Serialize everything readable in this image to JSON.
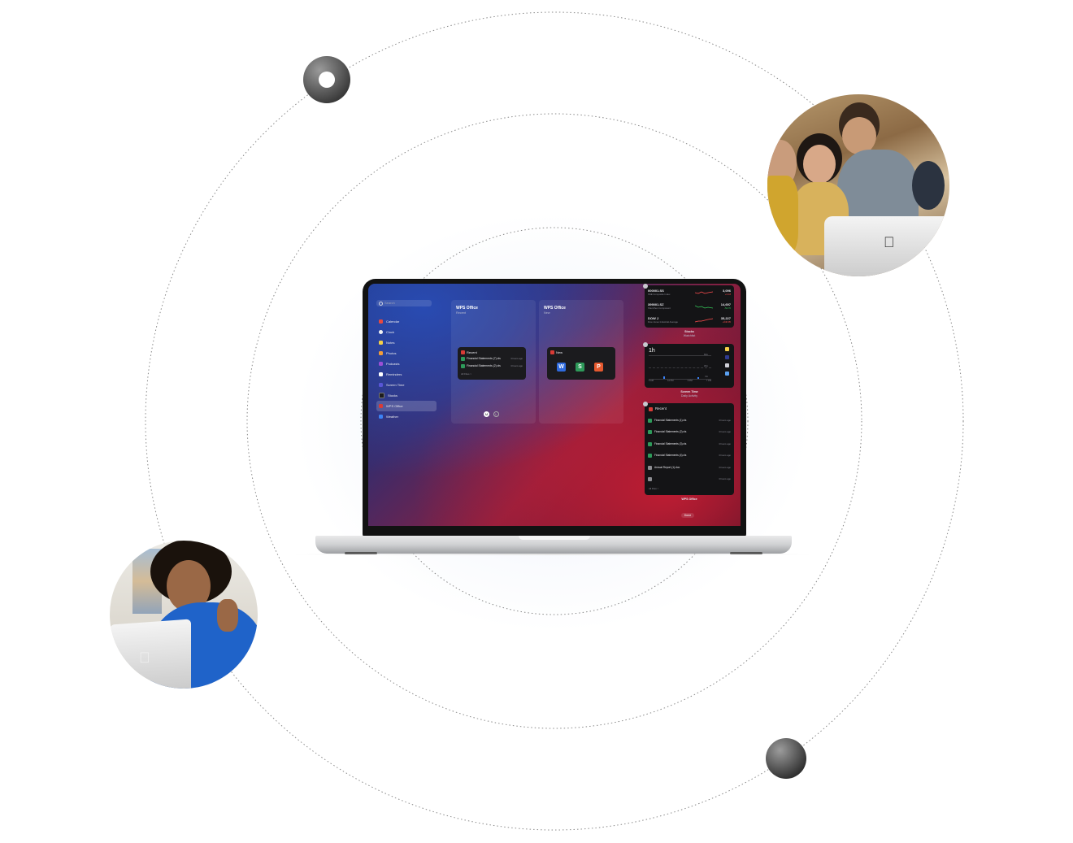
{
  "screen": {
    "search": {
      "placeholder": "Search"
    },
    "sidebar": {
      "items": [
        {
          "label": "Calendar",
          "color": "#e8493f"
        },
        {
          "label": "Clock",
          "color": "#f2f2f2"
        },
        {
          "label": "Notes",
          "color": "#f6cf47"
        },
        {
          "label": "Photos",
          "color": "#f29c38"
        },
        {
          "label": "Podcasts",
          "color": "#9b4fd6"
        },
        {
          "label": "Reminders",
          "color": "#ffffff"
        },
        {
          "label": "Screen Time",
          "color": "#5856d6"
        },
        {
          "label": "Stocks",
          "color": "#1c1c1e"
        },
        {
          "label": "WPS Office",
          "color": "#d93b36"
        },
        {
          "label": "Weather",
          "color": "#3b82f6"
        }
      ],
      "active_index": 8
    },
    "panels": [
      {
        "title": "WPS Office",
        "subtitle": "Recent",
        "widget_title": "Recent",
        "files": [
          {
            "name": "Financial Statements (7).xls",
            "time": "3 hours ago"
          },
          {
            "name": "Financial Statements (2).xls",
            "time": "3 hours ago"
          }
        ],
        "footer": "All Files >"
      },
      {
        "title": "WPS Office",
        "subtitle": "New",
        "widget_title": "New",
        "letters": [
          "W",
          "S",
          "P"
        ]
      }
    ],
    "pager": {
      "current": "M",
      "other": "L"
    },
    "stocks": {
      "rows": [
        {
          "symbol": "000001.SS",
          "name": "SSE Composite Index",
          "price": "3,096",
          "change": "+3.18",
          "color": "#ff4d4f"
        },
        {
          "symbol": "399001.SZ",
          "name": "Shenzhen Component",
          "price": "14,697",
          "change": "-54.76",
          "color": "#34c759"
        },
        {
          "symbol": "DOW J",
          "name": "Dow Jones Industrial Average",
          "price": "35,227",
          "change": "+646.95",
          "color": "#ff4d4f"
        }
      ],
      "caption_title": "Stocks",
      "caption_sub": "Watchlist"
    },
    "screen_time": {
      "value": "1h",
      "grid_labels": [
        "60m",
        "30m",
        "0m"
      ],
      "axis": [
        "6 AM",
        "12 PM",
        "6 PM",
        "7 PM"
      ],
      "caption_title": "Screen Time",
      "caption_sub": "Daily Activity"
    },
    "recent_widget": {
      "title": "Recent",
      "files": [
        {
          "name": "Financial Statements (1).xls",
          "time": "3 hours ago",
          "color": "#2e9a5a"
        },
        {
          "name": "Financial Statements (2).xls",
          "time": "3 hours ago",
          "color": "#2e9a5a"
        },
        {
          "name": "Financial Statements (3).xls",
          "time": "3 hours ago",
          "color": "#2e9a5a"
        },
        {
          "name": "Financial Statements (4).xls",
          "time": "3 hours ago",
          "color": "#2e9a5a"
        },
        {
          "name": "Annual Report (1).doc",
          "time": "3 hours ago",
          "color": "#8d8d92"
        },
        {
          "name": "",
          "time": "3 hours ago",
          "color": "#8d8d92"
        }
      ],
      "footer": "All Files >",
      "caption_title": "WPS Office"
    },
    "done_label": "Done"
  }
}
